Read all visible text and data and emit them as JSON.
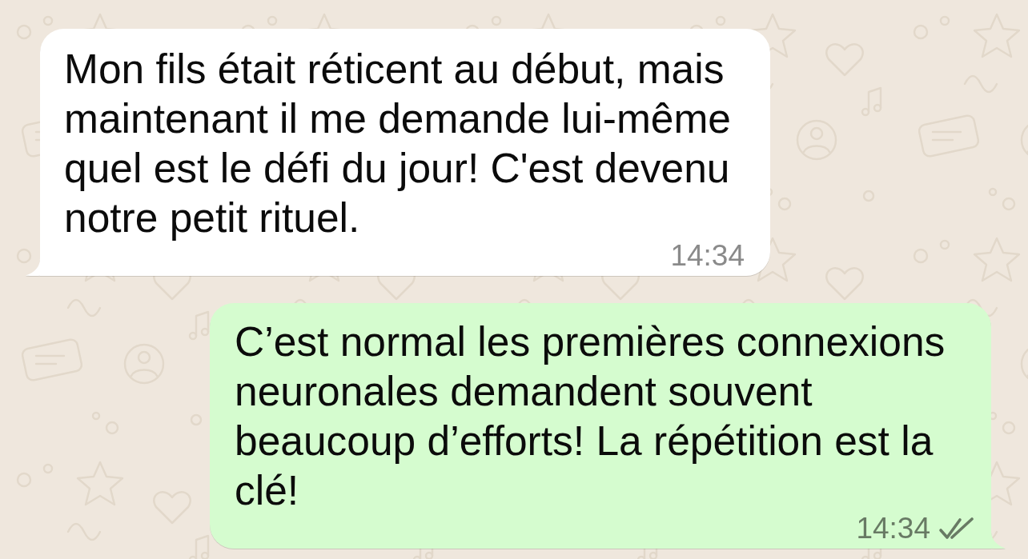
{
  "messages": [
    {
      "kind": "incoming",
      "text": "Mon fils était réticent au début, mais maintenant il me demande lui-même quel est le défi du jour! C'est devenu notre petit rituel.",
      "time": "14:34"
    },
    {
      "kind": "outgoing",
      "text": "C’est normal les premières connexions neuronales demandent souvent beaucoup d’efforts! La répétition est la clé!",
      "time": "14:34",
      "read": false
    }
  ]
}
